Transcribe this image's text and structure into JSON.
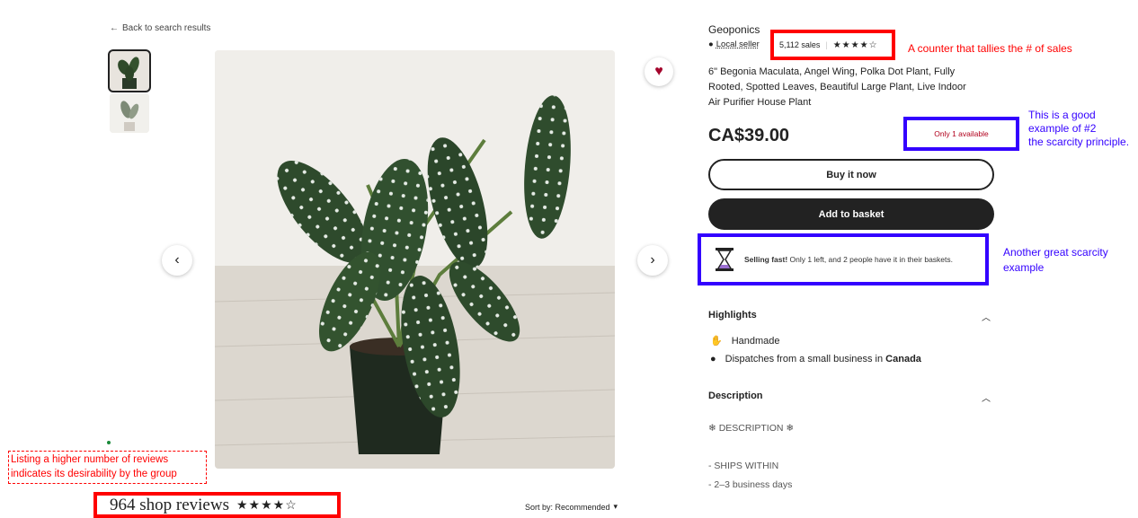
{
  "nav": {
    "back_label": "Back to search results",
    "back_icon": "arrow-left-icon"
  },
  "gallery": {
    "prev_icon": "chevron-left-icon",
    "next_icon": "chevron-right-icon",
    "favorite_icon": "heart-icon",
    "favorite_color": "#a4052c"
  },
  "shop": {
    "name": "Geoponics",
    "local_label": "Local seller",
    "sales": "5,112 sales",
    "stars": "★★★★☆",
    "sales_annotation": "A counter that tallies the # of sales"
  },
  "product": {
    "title": "6\" Begonia Maculata, Angel Wing, Polka Dot Plant, Fully Rooted, Spotted Leaves, Beautiful Large Plant, Live Indoor Air Purifier House Plant",
    "price": "CA$39.00",
    "availability": "Only 1 available",
    "availability_annotation": [
      "This is a good",
      "example of #2",
      "the scarcity principle."
    ]
  },
  "actions": {
    "buy_now": "Buy it now",
    "add_to_basket": "Add to basket"
  },
  "selling_fast": {
    "bold": "Selling fast!",
    "text": " Only 1 left, and 2 people have it in their baskets.",
    "icon": "hourglass-icon",
    "annotation": [
      "Another great scarcity",
      "example"
    ]
  },
  "highlights": {
    "heading": "Highlights",
    "items": [
      {
        "icon": "hand-icon",
        "text": "Handmade"
      },
      {
        "icon": "location-pin-icon",
        "text": "Dispatches from a small business in ",
        "bold": "Canada"
      }
    ]
  },
  "description": {
    "heading": "Description",
    "lines": [
      "❄ DESCRIPTION ❄",
      "- SHIPS WITHIN",
      "- 2–3 business days"
    ]
  },
  "reviews": {
    "annotation": [
      "Listing a higher number of reviews",
      "indicates its desirability by the group"
    ],
    "count_label": "964 shop reviews",
    "stars": "★★★★☆",
    "sort_label": "Sort by: Recommended"
  },
  "colors": {
    "annotation_red": "#ff0000",
    "annotation_blue": "#3300ff",
    "button_dark": "#222222"
  }
}
